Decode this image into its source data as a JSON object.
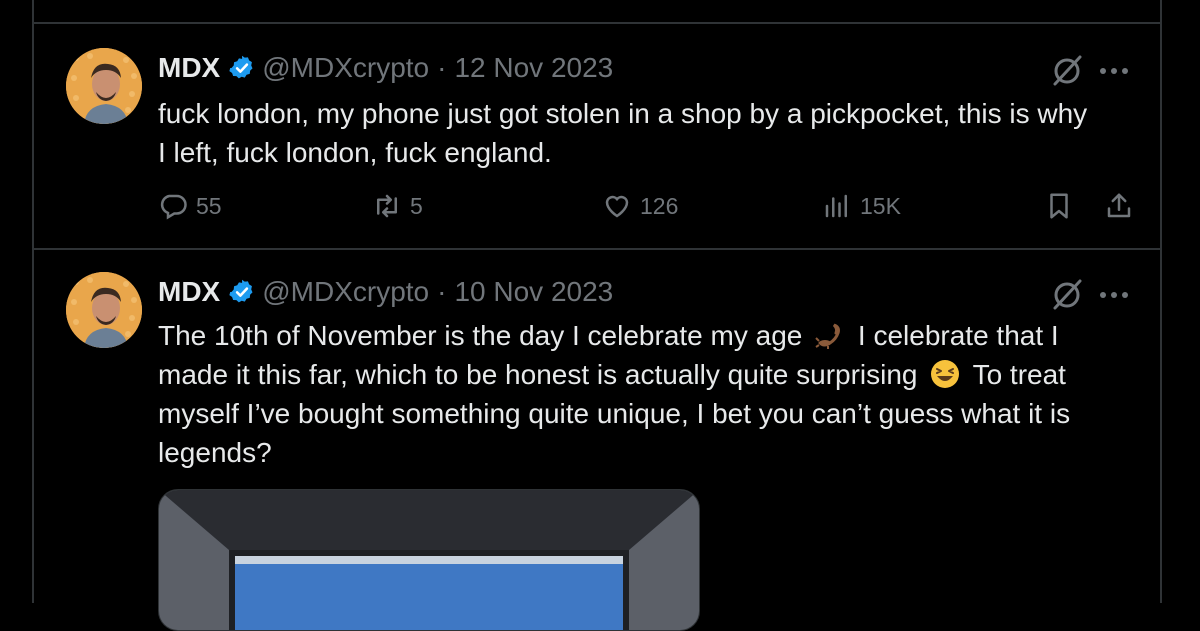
{
  "colors": {
    "background": "#000000",
    "text": "#e7e9ea",
    "muted": "#71767b",
    "verified": "#1d9bf0",
    "border": "#2f3336"
  },
  "tweets": [
    {
      "name": "MDX",
      "handle": "@MDXcrypto",
      "separator": "·",
      "date": "12 Nov 2023",
      "text_lines": [
        "fuck london, my phone just got stolen in a shop by a pickpocket, this is why",
        "I left, fuck london, fuck england."
      ],
      "replies": "55",
      "reposts": "5",
      "likes": "126",
      "views": "15K"
    },
    {
      "name": "MDX",
      "handle": "@MDXcrypto",
      "separator": "·",
      "date": "10 Nov 2023",
      "text_line1_a": "The 10th of November is the day I celebrate my age",
      "text_line1_b": "I celebrate that I",
      "text_line2_a": "made it this far, which to be honest is actually quite surprising",
      "text_line2_b": "To treat",
      "text_line3": "myself I’ve bought something quite unique, I bet you can’t guess what it is",
      "text_line4": "legends?",
      "emojis": [
        "scorpion-emoji",
        "laughing-emoji"
      ]
    }
  ],
  "icons": [
    "verified-badge-icon",
    "grok-icon",
    "more-icon",
    "reply-icon",
    "repost-icon",
    "like-icon",
    "views-icon",
    "bookmark-icon",
    "share-icon"
  ]
}
